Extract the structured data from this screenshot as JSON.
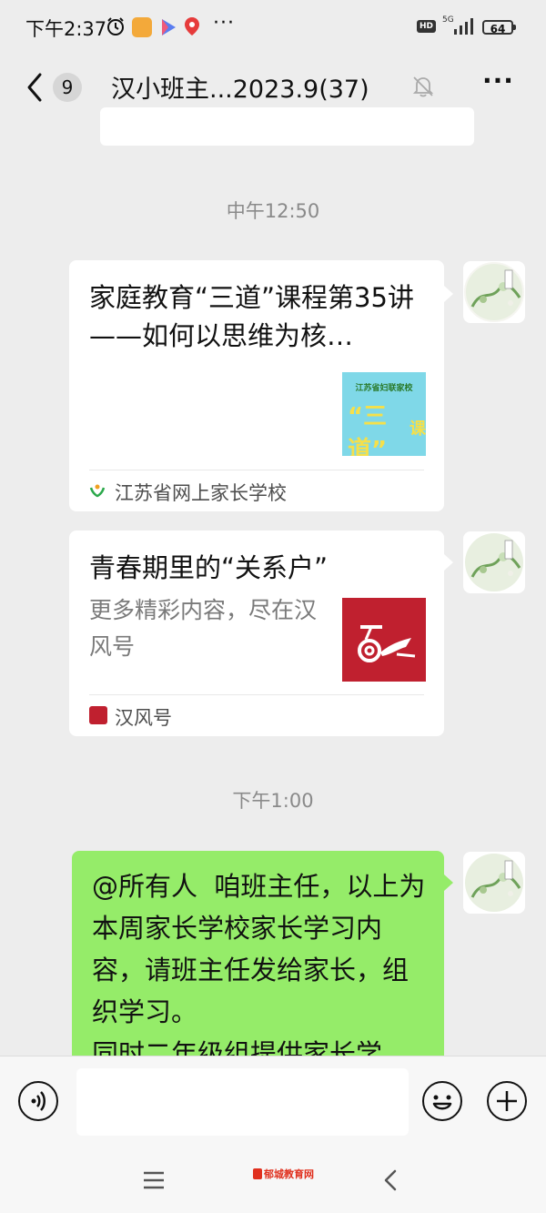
{
  "status_bar": {
    "time": "下午2:37",
    "network": "5G",
    "hd": "HD",
    "battery": "64",
    "dots": "···"
  },
  "header": {
    "unread_count": "9",
    "title": "汉小班主...2023.9(37)",
    "more": "···"
  },
  "chat": {
    "prev_bubble_partial": "",
    "timestamp_1": "中午12:50",
    "card_1": {
      "title": "家庭教育“三道”课程第35讲——如何以思维为核…",
      "thumb_text_top": "江苏省妇联家校",
      "thumb_text_main": "“三道”",
      "thumb_text_side": "课",
      "source": "江苏省网上家长学校"
    },
    "card_2": {
      "title": "青春期里的“关系户”",
      "desc": "更多精彩内容，尽在汉风号",
      "source": "汉风号"
    },
    "timestamp_2": "下午1:00",
    "message_3": "@所有人  咱班主任，以上为本周家长学校家长学习内容，请班主任发给家长，组织学习。\n同时二年级组提供家长学"
  },
  "input_bar": {
    "placeholder": ""
  },
  "watermark": "郁城教育网",
  "colors": {
    "chat_bg": "#ededed",
    "green_bubble": "#95ec69",
    "card_bg": "#ffffff",
    "hanfeng_red": "#c0202f"
  }
}
